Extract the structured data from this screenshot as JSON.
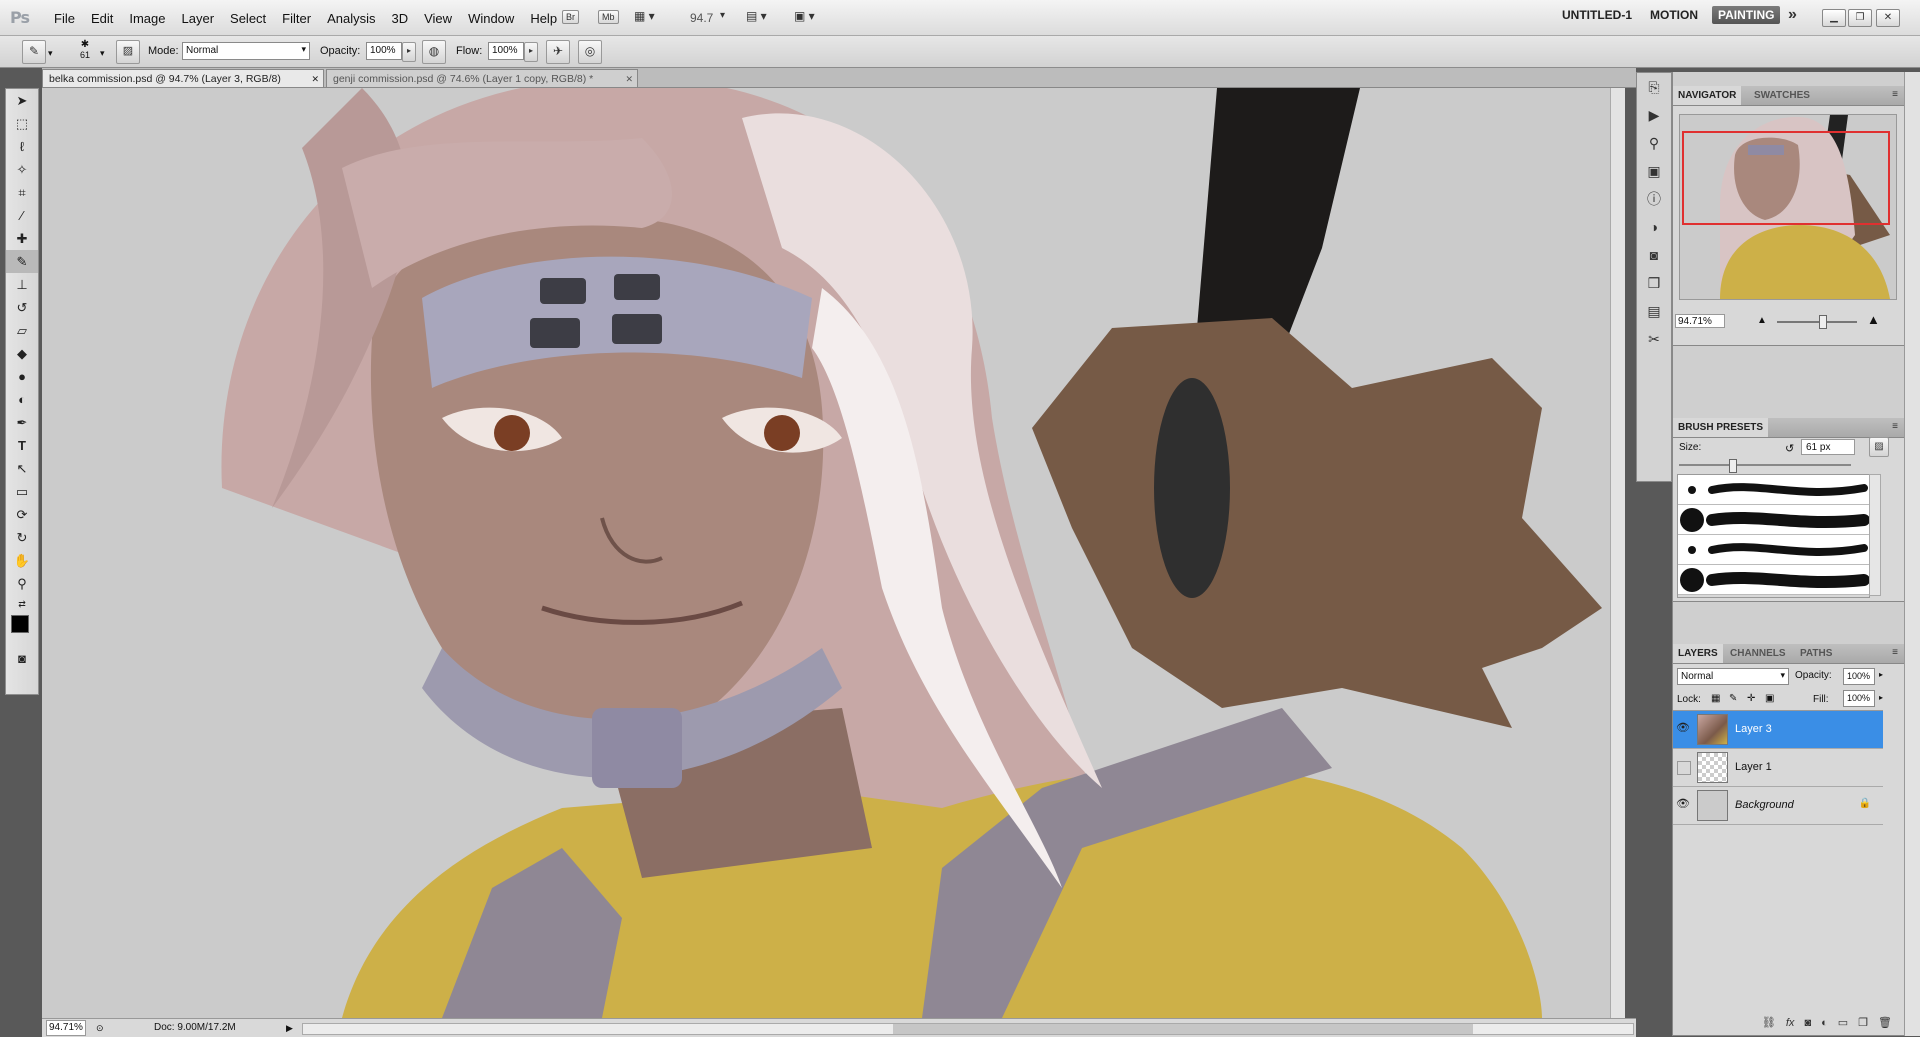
{
  "app": {
    "logo": "Ps",
    "menus": [
      "File",
      "Edit",
      "Image",
      "Layer",
      "Select",
      "Filter",
      "Analysis",
      "3D",
      "View",
      "Window",
      "Help"
    ],
    "bridge_labels": [
      "Br",
      "Mb"
    ],
    "zoom_value": "94.7",
    "workspaces": [
      "UNTITLED-1",
      "MOTION",
      "PAINTING"
    ],
    "active_workspace": "PAINTING",
    "expand_glyph": "»"
  },
  "options": {
    "brush_size": "61",
    "mode_label": "Mode:",
    "mode_value": "Normal",
    "opacity_label": "Opacity:",
    "opacity_value": "100%",
    "flow_label": "Flow:",
    "flow_value": "100%"
  },
  "tabs": [
    {
      "label": "belka commission.psd @ 94.7% (Layer 3, RGB/8)",
      "close": "✕"
    },
    {
      "label": "genji commission.psd @ 74.6% (Layer 1 copy, RGB/8) *",
      "close": "✕"
    }
  ],
  "status": {
    "zoom": "94.71%",
    "doc": "Doc: 9.00M/17.2M"
  },
  "navigator": {
    "tabs": [
      "NAVIGATOR",
      "SWATCHES"
    ],
    "zoom": "94.71%"
  },
  "brush_presets": {
    "title": "BRUSH PRESETS",
    "size_label": "Size:",
    "size_value": "61 px"
  },
  "layers_panel": {
    "tabs": [
      "LAYERS",
      "CHANNELS",
      "PATHS"
    ],
    "blend_mode": "Normal",
    "opacity_label": "Opacity:",
    "opacity_value": "100%",
    "lock_label": "Lock:",
    "fill_label": "Fill:",
    "fill_value": "100%",
    "layers": [
      {
        "name": "Layer 3",
        "visible": true,
        "selected": true
      },
      {
        "name": "Layer 1",
        "visible": false,
        "selected": false
      },
      {
        "name": "Background",
        "visible": true,
        "selected": false,
        "locked": true
      }
    ]
  },
  "colors": {
    "selection": "#3a8ee6",
    "canvas_bg": "#cbcbcb"
  },
  "icons": {
    "eye": "eye-icon",
    "lock": "lock-icon",
    "close": "close-icon"
  }
}
